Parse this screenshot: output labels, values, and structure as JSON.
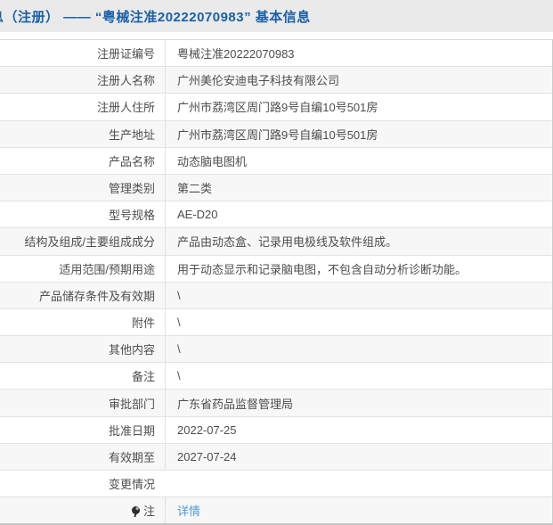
{
  "title": {
    "clipped_prefix": "息",
    "text": "（注册） —— “粤械注准20222070983” 基本信息"
  },
  "colors": {
    "title_blue": "#1a60a8",
    "link_blue": "#4e9ad8",
    "titlebar_bg": "#eaeaea",
    "alt_row_bg": "#f7f7f7",
    "text_gray": "#4d4d4d"
  },
  "table": {
    "rows": [
      {
        "label": "注册证编号",
        "value": "粤械注准20222070983"
      },
      {
        "label": "注册人名称",
        "value": "广州美伦安迪电子科技有限公司"
      },
      {
        "label": "注册人住所",
        "value": "广州市荔湾区周门路9号自编10号501房"
      },
      {
        "label": "生产地址",
        "value": "广州市荔湾区周门路9号自编10号501房"
      },
      {
        "label": "产品名称",
        "value": "动态脑电图机"
      },
      {
        "label": "管理类别",
        "value": "第二类"
      },
      {
        "label": "型号规格",
        "value": "AE-D20"
      },
      {
        "label": "结构及组成/主要组成成分",
        "value": "产品由动态盒、记录用电极线及软件组成。"
      },
      {
        "label": "适用范围/预期用途",
        "value": "用于动态显示和记录脑电图，不包含自动分析诊断功能。"
      },
      {
        "label": "产品储存条件及有效期",
        "value": "\\"
      },
      {
        "label": "附件",
        "value": "\\"
      },
      {
        "label": "其他内容",
        "value": "\\"
      },
      {
        "label": "备注",
        "value": "\\"
      },
      {
        "label": "审批部门",
        "value": "广东省药品监督管理局"
      },
      {
        "label": "批准日期",
        "value": "2022-07-25"
      },
      {
        "label": "有效期至",
        "value": "2027-07-24"
      },
      {
        "label": "变更情况",
        "value": "",
        "no_divider": true
      },
      {
        "label": "注",
        "value": "详情",
        "link": true,
        "icon": "balloon-note"
      }
    ]
  }
}
